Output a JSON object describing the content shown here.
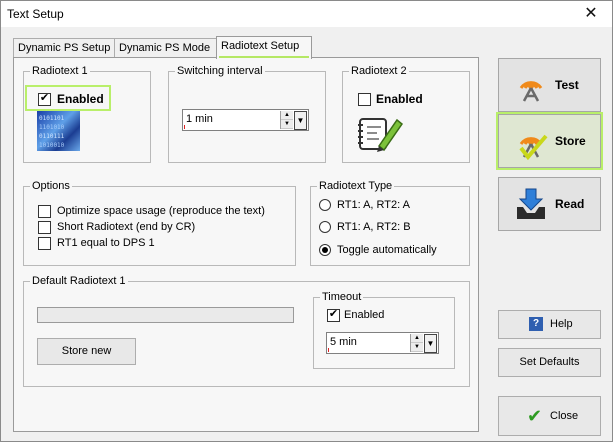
{
  "window": {
    "title": "Text Setup",
    "close_glyph": "✕"
  },
  "tabs": [
    {
      "label": "Dynamic PS Setup"
    },
    {
      "label": "Dynamic PS Mode"
    },
    {
      "label": "Radiotext Setup",
      "active": true
    }
  ],
  "radiotext1": {
    "legend": "Radiotext 1",
    "enabled_label": "Enabled",
    "enabled": true
  },
  "switching": {
    "legend": "Switching interval",
    "value": "1 min"
  },
  "radiotext2": {
    "legend": "Radiotext 2",
    "enabled_label": "Enabled",
    "enabled": false
  },
  "options": {
    "legend": "Options",
    "items": [
      {
        "label": "Optimize space usage (reproduce the text)",
        "checked": false
      },
      {
        "label": "Short Radiotext (end by CR)",
        "checked": false
      },
      {
        "label": "RT1 equal to DPS 1",
        "checked": false
      }
    ]
  },
  "rt_type": {
    "legend": "Radiotext Type",
    "items": [
      {
        "label": "RT1: A, RT2: A",
        "selected": false
      },
      {
        "label": "RT1: A, RT2: B",
        "selected": false
      },
      {
        "label": "Toggle automatically",
        "selected": true
      }
    ]
  },
  "default_rt1": {
    "legend": "Default Radiotext 1",
    "store_new_label": "Store new"
  },
  "timeout": {
    "legend": "Timeout",
    "enabled_label": "Enabled",
    "enabled": true,
    "value": "5 min"
  },
  "side_buttons": {
    "test": "Test",
    "store": "Store",
    "read": "Read",
    "help": "Help",
    "set_defaults": "Set Defaults",
    "close": "Close"
  },
  "icons": {
    "check": "✔",
    "spin_up": "▲",
    "spin_down": "▼",
    "drop": "▼"
  },
  "colors": {
    "highlight": "#b9ef6a",
    "accent_orange": "#f08a1a",
    "download_blue": "#2f7fd8"
  }
}
